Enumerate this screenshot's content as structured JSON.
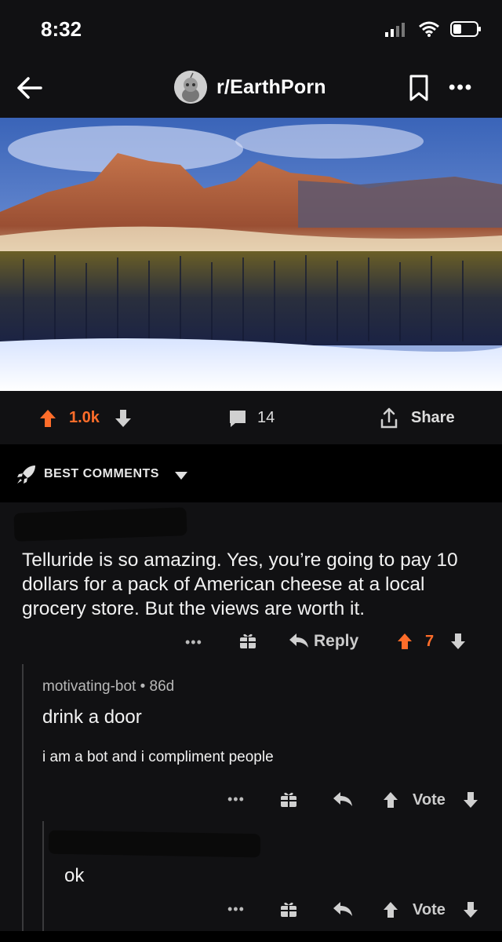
{
  "status_bar": {
    "time": "8:32"
  },
  "header": {
    "subreddit": "r/EarthPorn",
    "more": "•••"
  },
  "post_actions": {
    "score": "1.0k",
    "comment_count": "14",
    "share_label": "Share"
  },
  "sort": {
    "label": "BEST COMMENTS"
  },
  "comments": [
    {
      "text": "Telluride is so amazing. Yes, you’re going to pay 10 dollars for a pack of American cheese at a local grocery store. But the views are worth it.",
      "reply_label": "Reply",
      "score": "7",
      "more": "•••"
    },
    {
      "meta": "motivating-bot • 86d",
      "title": "drink a door",
      "body": "i am a bot and i compliment people",
      "vote_label": "Vote",
      "more": "•••"
    },
    {
      "text": "ok",
      "vote_label": "Vote",
      "more": "•••"
    }
  ],
  "colors": {
    "accent": "#ff6d2a",
    "background": "#111113",
    "sort_bar": "#000000"
  },
  "icons": [
    "back-arrow-icon",
    "subreddit-avatar",
    "save-icon",
    "more-icon",
    "upvote-icon",
    "downvote-icon",
    "comment-icon",
    "share-icon",
    "rocket-icon",
    "caret-down-icon",
    "gift-icon",
    "reply-icon"
  ]
}
